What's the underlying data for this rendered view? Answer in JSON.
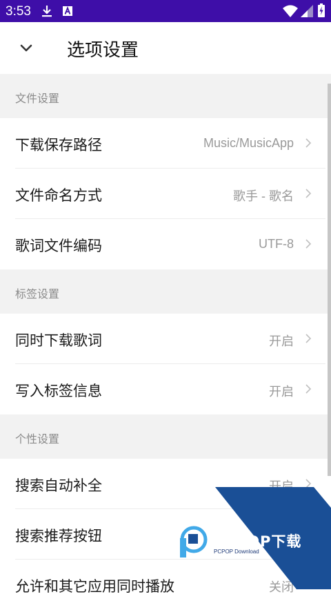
{
  "status_bar": {
    "time": "3:53",
    "left_icons": [
      "download-icon",
      "a-app-icon"
    ],
    "right_icons": [
      "wifi-icon",
      "cell-signal-icon",
      "battery-charging-icon"
    ],
    "background": "#3e0ea8"
  },
  "app_bar": {
    "title": "选项设置",
    "back_icon": "chevron-down-icon"
  },
  "sections": [
    {
      "header": "文件设置",
      "rows": [
        {
          "label": "下载保存路径",
          "value": "Music/MusicApp"
        },
        {
          "label": "文件命名方式",
          "value": "歌手 - 歌名"
        },
        {
          "label": "歌词文件编码",
          "value": "UTF-8"
        }
      ]
    },
    {
      "header": "标签设置",
      "rows": [
        {
          "label": "同时下载歌词",
          "value": "开启"
        },
        {
          "label": "写入标签信息",
          "value": "开启"
        }
      ]
    },
    {
      "header": "个性设置",
      "rows": [
        {
          "label": "搜索自动补全",
          "value": "开启"
        },
        {
          "label": "搜索推荐按钮",
          "value": ""
        },
        {
          "label": "允许和其它应用同时播放",
          "value": "关闭"
        }
      ]
    }
  ],
  "watermark": {
    "brand": "PCPOP下载",
    "subtitle": "PCPOP Download",
    "colors": {
      "dark_blue": "#1a4f96",
      "light_blue": "#41a9e8"
    }
  }
}
